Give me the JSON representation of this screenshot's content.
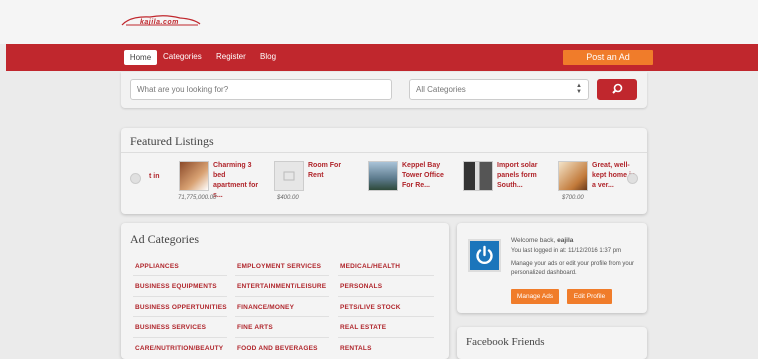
{
  "header": {
    "logo_text": "kajila.com"
  },
  "nav": {
    "items": [
      "Home",
      "Categories",
      "Register",
      "Blog"
    ],
    "post_ad_label": "Post an Ad"
  },
  "search": {
    "placeholder": "What are you looking for?",
    "category_selected": "All Categories"
  },
  "featured": {
    "title": "Featured Listings",
    "partial_text": "t in",
    "listings": [
      {
        "title": "Charming 3 bed apartment for s...",
        "price": "71,775,000.00"
      },
      {
        "title": "Room For Rent",
        "price": "$400.00"
      },
      {
        "title": "Keppel Bay Tower Office For Re...",
        "price": ""
      },
      {
        "title": "Import solar panels form South...",
        "price": ""
      },
      {
        "title": "Great, well-kept home in a ver...",
        "price": "$700.00"
      }
    ]
  },
  "ad_categories": {
    "title": "Ad Categories",
    "columns": [
      [
        "APPLIANCES",
        "BUSINESS EQUIPMENTS",
        "BUSINESS OPPERTUNITIES",
        "BUSINESS SERVICES",
        "CARE/NUTRITION/BEAUTY"
      ],
      [
        "EMPLOYMENT SERVICES",
        "ENTERTAINMENT/LEISURE",
        "FINANCE/MONEY",
        "FINE ARTS",
        "FOOD AND BEVERAGES"
      ],
      [
        "MEDICAL/HEALTH",
        "PERSONALS",
        "PETS/LIVE STOCK",
        "REAL ESTATE",
        "RENTALS"
      ]
    ]
  },
  "welcome": {
    "greeting_prefix": "Welcome back,",
    "username": "eajila",
    "last_login": "You last logged in at: 11/12/2016 1:37 pm",
    "description": "Manage your ads or edit your profile from your personalized dashboard.",
    "manage_ads_label": "Manage Ads",
    "edit_profile_label": "Edit Profile"
  },
  "facebook": {
    "title": "Facebook Friends"
  },
  "colors": {
    "brand_red": "#c0272d",
    "accent_orange": "#f07c2a",
    "icon_blue": "#1b75bb"
  }
}
